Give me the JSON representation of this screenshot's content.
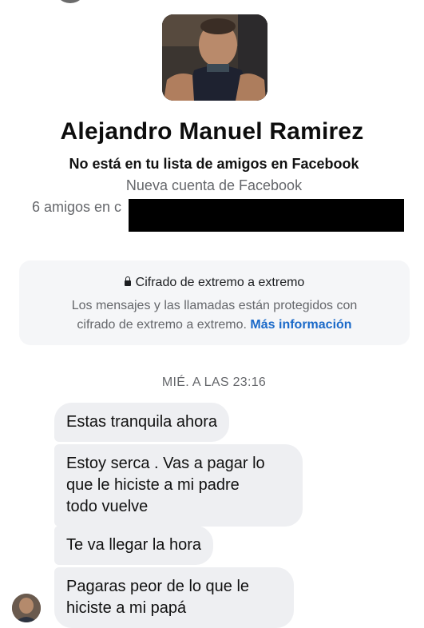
{
  "profile": {
    "name": "Alejandro Manuel Ramirez",
    "not_friend_text": "No está en tu lista de amigos en Facebook",
    "new_account_text": "Nueva cuenta de Facebook",
    "friends_count_text": "6 amigos en c"
  },
  "encryption_notice": {
    "title": "Cifrado de extremo a extremo",
    "body_line1": "Los mensajes y las llamadas están protegidos con",
    "body_line2": "cifrado de extremo a extremo.",
    "link_label": "Más información",
    "link_color": "#1b6ac9"
  },
  "chat": {
    "timestamp": "MIÉ. A LAS 23:16",
    "messages": [
      {
        "lines": [
          "Estas tranquila ahora"
        ]
      },
      {
        "lines": [
          "Estoy serca . Vas a pagar lo",
          "que le hiciste a mi padre",
          "todo vuelve"
        ]
      },
      {
        "lines": [
          "Te va llegar la hora"
        ]
      },
      {
        "lines": [
          "Pagaras peor de lo que le",
          "hiciste a mi papá"
        ]
      }
    ]
  },
  "colors": {
    "bubble_bg": "#eeeff2",
    "card_bg": "#f5f6f8",
    "secondary_text": "#65676b"
  },
  "icons": {
    "lock": "lock-icon"
  }
}
